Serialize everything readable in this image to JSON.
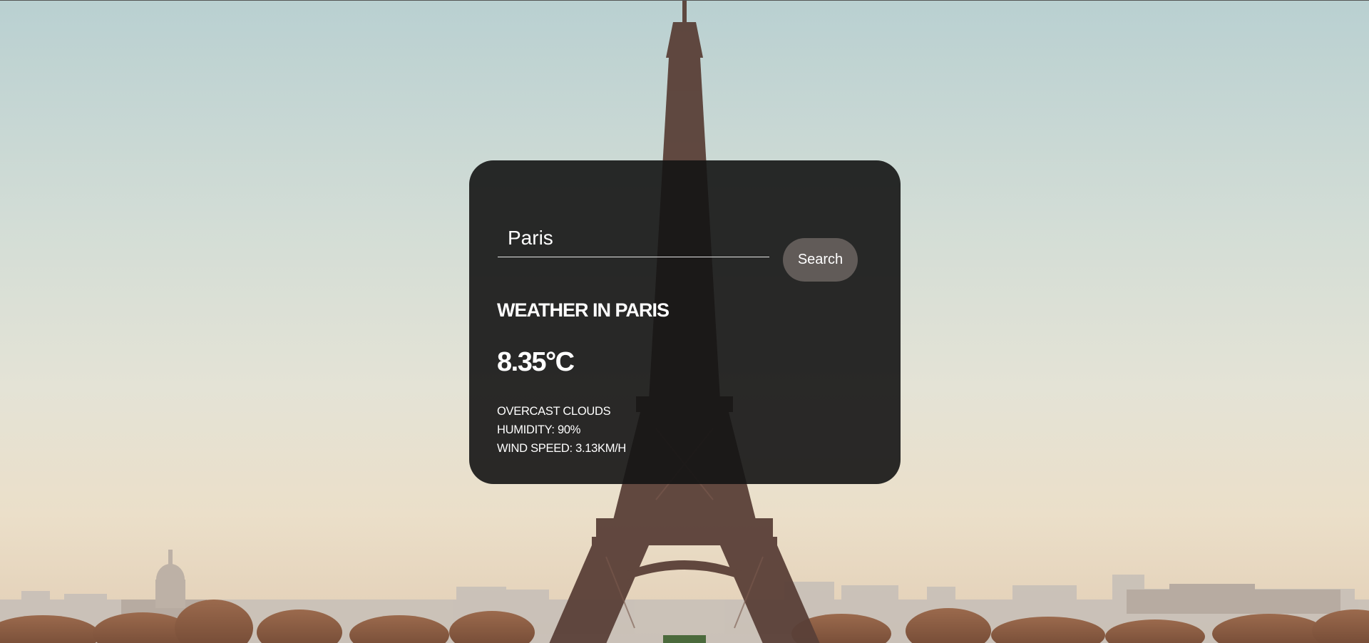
{
  "search": {
    "value": "Paris",
    "button_label": "Search"
  },
  "weather": {
    "title": "WEATHER IN PARIS",
    "temperature": "8.35°C",
    "description": "OVERCAST CLOUDS",
    "humidity": "HUMIDITY: 90%",
    "wind_speed": "WIND SPEED: 3.13KM/H"
  },
  "colors": {
    "card_background": "#141414",
    "button_background": "#615b58",
    "text": "#ffffff"
  }
}
